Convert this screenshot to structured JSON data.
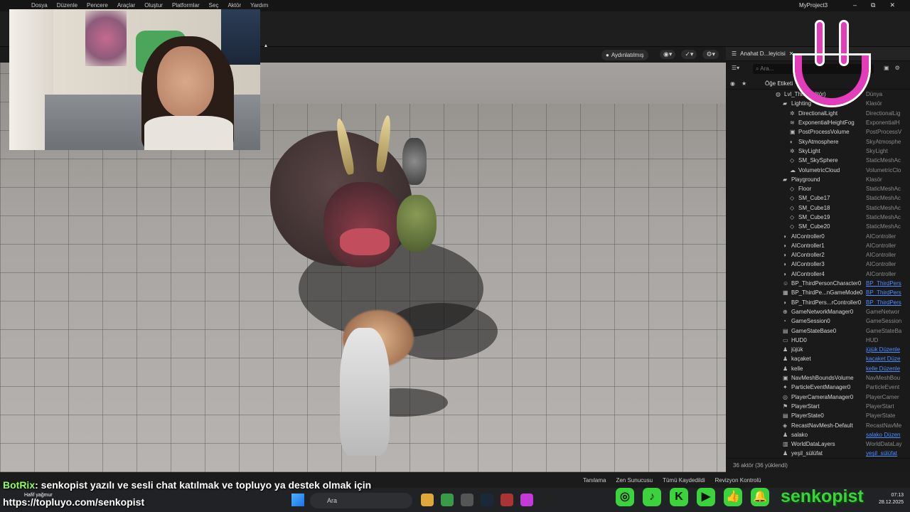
{
  "menubar": {
    "items": [
      "Dosya",
      "Düzenle",
      "Pencere",
      "Araçlar",
      "Oluştur",
      "Platformlar",
      "Seç",
      "Aktör",
      "Yardım"
    ],
    "project": "MyProject3",
    "win_min": "–",
    "win_max": "⧉",
    "win_close": "✕"
  },
  "viewport": {
    "lit_label": "Aydınlatılmış"
  },
  "outliner": {
    "tab_title": "Anahat D...leyicisi",
    "search_placeholder": "Ara...",
    "header_label": "Öğe Etiketi",
    "rows": [
      {
        "name": "Lvl_Thi...(Editör)",
        "type": "Dünya",
        "indent": 1,
        "icon": "world-icon"
      },
      {
        "name": "Lighting",
        "type": "Klasör",
        "indent": 2,
        "icon": "folder-icon"
      },
      {
        "name": "DirectionalLight",
        "type": "DirectionalLig",
        "indent": 3,
        "icon": "light-icon"
      },
      {
        "name": "ExponentialHeightFog",
        "type": "ExponentialH",
        "indent": 3,
        "icon": "fog-icon"
      },
      {
        "name": "PostProcessVolume",
        "type": "PostProcessV",
        "indent": 3,
        "icon": "volume-icon"
      },
      {
        "name": "SkyAtmosphere",
        "type": "SkyAtmosphe",
        "indent": 3,
        "icon": "sky-icon"
      },
      {
        "name": "SkyLight",
        "type": "SkyLight",
        "indent": 3,
        "icon": "light-icon"
      },
      {
        "name": "SM_SkySphere",
        "type": "StaticMeshAc",
        "indent": 3,
        "icon": "mesh-icon"
      },
      {
        "name": "VolumetricCloud",
        "type": "VolumetricClo",
        "indent": 3,
        "icon": "cloud-icon"
      },
      {
        "name": "Playground",
        "type": "Klasör",
        "indent": 2,
        "icon": "folder-icon"
      },
      {
        "name": "Floor",
        "type": "StaticMeshAc",
        "indent": 3,
        "icon": "mesh-icon"
      },
      {
        "name": "SM_Cube17",
        "type": "StaticMeshAc",
        "indent": 3,
        "icon": "mesh-icon"
      },
      {
        "name": "SM_Cube18",
        "type": "StaticMeshAc",
        "indent": 3,
        "icon": "mesh-icon"
      },
      {
        "name": "SM_Cube19",
        "type": "StaticMeshAc",
        "indent": 3,
        "icon": "mesh-icon"
      },
      {
        "name": "SM_Cube20",
        "type": "StaticMeshAc",
        "indent": 3,
        "icon": "mesh-icon"
      },
      {
        "name": "AIController0",
        "type": "AIController",
        "indent": 2,
        "icon": "controller-icon"
      },
      {
        "name": "AIController1",
        "type": "AIController",
        "indent": 2,
        "icon": "controller-icon"
      },
      {
        "name": "AIController2",
        "type": "AIController",
        "indent": 2,
        "icon": "controller-icon"
      },
      {
        "name": "AIController3",
        "type": "AIController",
        "indent": 2,
        "icon": "controller-icon"
      },
      {
        "name": "AIController4",
        "type": "AIController",
        "indent": 2,
        "icon": "controller-icon"
      },
      {
        "name": "BP_ThirdPersonCharacter0",
        "type": "BP_ThirdPers",
        "indent": 2,
        "icon": "character-icon",
        "link": true
      },
      {
        "name": "BP_ThirdPe...nGameMode0",
        "type": "BP_ThirdPers",
        "indent": 2,
        "icon": "gamemode-icon",
        "link": true
      },
      {
        "name": "BP_ThirdPers...rController0",
        "type": "BP_ThirdPers",
        "indent": 2,
        "icon": "controller-icon",
        "link": true
      },
      {
        "name": "GameNetworkManager0",
        "type": "GameNetwor",
        "indent": 2,
        "icon": "network-icon"
      },
      {
        "name": "GameSession0",
        "type": "GameSession",
        "indent": 2,
        "icon": "session-icon"
      },
      {
        "name": "GameStateBase0",
        "type": "GameStateBa",
        "indent": 2,
        "icon": "state-icon"
      },
      {
        "name": "HUD0",
        "type": "HUD",
        "indent": 2,
        "icon": "hud-icon"
      },
      {
        "name": "jüjük",
        "type": "jüjük Düzenle",
        "indent": 2,
        "icon": "pawn-icon",
        "link": true
      },
      {
        "name": "kaçaket",
        "type": "kaçaket Düze",
        "indent": 2,
        "icon": "pawn-icon",
        "link": true
      },
      {
        "name": "kelle",
        "type": "kelle Düzenle",
        "indent": 2,
        "icon": "pawn-icon",
        "link": true
      },
      {
        "name": "NavMeshBoundsVolume",
        "type": "NavMeshBou",
        "indent": 2,
        "icon": "volume-icon"
      },
      {
        "name": "ParticleEventManager0",
        "type": "ParticleEvent",
        "indent": 2,
        "icon": "particle-icon"
      },
      {
        "name": "PlayerCameraManager0",
        "type": "PlayerCamer",
        "indent": 2,
        "icon": "camera-icon"
      },
      {
        "name": "PlayerStart",
        "type": "PlayerStart",
        "indent": 2,
        "icon": "start-icon"
      },
      {
        "name": "PlayerState0",
        "type": "PlayerState",
        "indent": 2,
        "icon": "state-icon"
      },
      {
        "name": "RecastNavMesh-Default",
        "type": "RecastNavMe",
        "indent": 2,
        "icon": "navmesh-icon"
      },
      {
        "name": "salako",
        "type": "salako Düzen",
        "indent": 2,
        "icon": "pawn-icon",
        "link": true
      },
      {
        "name": "WorldDataLayers",
        "type": "WorldDataLay",
        "indent": 2,
        "icon": "layers-icon"
      },
      {
        "name": "yeşil_sülüfat",
        "type": "yeşil_sülüfat",
        "indent": 2,
        "icon": "pawn-icon",
        "link": true
      }
    ],
    "footer": "36 aktör (36 yüklendi)"
  },
  "ue_status": {
    "items": [
      "Tanılama",
      "Zen Sunucusu",
      "Tümü Kaydedildi",
      "Revizyon Kontrolü"
    ]
  },
  "overlay": {
    "chat_user": "BotRix",
    "chat_msg": ": senkopist yazılı ve sesli chat katılmak ve topluyo ya destek olmak için",
    "url": "https://topluyo.com/senkopist",
    "tiny": "Hafif yağmur",
    "handle": "senkopist"
  },
  "taskbar": {
    "search": "Ara",
    "time": "07:13",
    "date": "28.12.2025"
  },
  "colors": {
    "accent_pink": "#e43dbc",
    "social_green": "#3bd33b",
    "link_blue": "#4d8dff"
  }
}
